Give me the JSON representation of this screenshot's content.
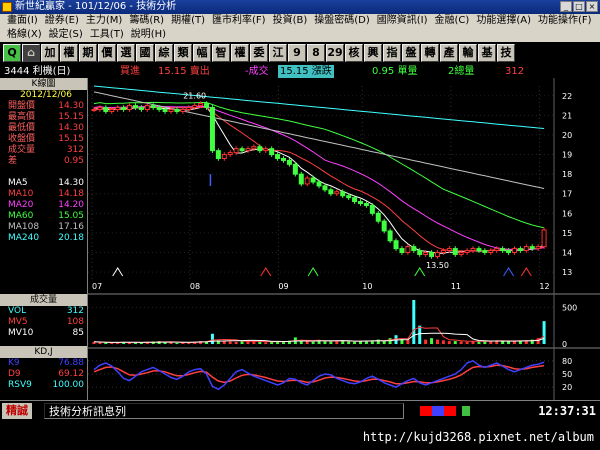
{
  "window": {
    "title": "新世紀贏家 - 101/12/06 - 技術分析"
  },
  "menu": {
    "row1": [
      "畫面(I)",
      "證券(E)",
      "主力(M)",
      "籌碼(R)",
      "期權(T)",
      "匯市利率(F)",
      "投資(B)",
      "操盤密碼(D)",
      "國際資訊(I)",
      "金融(C)",
      "功能選擇(A)",
      "功能操作(F)"
    ],
    "row2": [
      "格線(X)",
      "設定(S)",
      "工具(T)",
      "說明(H)"
    ]
  },
  "toolbar": {
    "buttons": [
      "Q",
      "⌂",
      "加",
      "權",
      "期",
      "價",
      "選",
      "國",
      "綜",
      "類",
      "幅",
      "智",
      "權",
      "委",
      "江",
      "9",
      "8",
      "29",
      "核",
      "興",
      "指",
      "盤",
      "轉",
      "產",
      "輪",
      "基",
      "技"
    ],
    "icons": [
      "search-icon",
      "home-icon"
    ]
  },
  "quote": {
    "stock": "3444 利機(日)",
    "bid_label": "買進",
    "bid_value": "15.15 賣出",
    "trade_label": "-成交",
    "trade_value": "15.15 漲跌",
    "change_value": "0.95 單量",
    "lots_value": "2總量",
    "total_value": "312"
  },
  "left_panel": {
    "k_header": "K線圖",
    "date": "2012/12/06",
    "price_rows": [
      {
        "k": "開盤價",
        "v": "14.30"
      },
      {
        "k": "最高價",
        "v": "15.15"
      },
      {
        "k": "最低價",
        "v": "14.30"
      },
      {
        "k": "收盤價",
        "v": "15.15"
      },
      {
        "k": "成交量",
        "v": "312"
      },
      {
        "k": "差",
        "v": "0.95"
      }
    ],
    "ma_rows": [
      {
        "k": "MA5",
        "v": "14.30",
        "color": "#ffffff"
      },
      {
        "k": "MA10",
        "v": "14.18",
        "color": "#ff4040"
      },
      {
        "k": "MA20",
        "v": "14.20",
        "color": "#ff40ff"
      },
      {
        "k": "MA60",
        "v": "15.05",
        "color": "#40ff40"
      },
      {
        "k": "MA108",
        "v": "17.16",
        "color": "#c0c0c0"
      },
      {
        "k": "MA240",
        "v": "20.18",
        "color": "#40ffff"
      }
    ],
    "vol_header": "成交量",
    "vol_rows": [
      {
        "k": "VOL",
        "v": "312",
        "color": "#40ffff"
      },
      {
        "k": "MV5",
        "v": "108",
        "color": "#ff4040"
      },
      {
        "k": "MV10",
        "v": "85",
        "color": "#ffffff"
      }
    ],
    "kd_header": "KD,J",
    "kd_rows": [
      {
        "k": "K9",
        "v": "76.88",
        "color": "#4040ff"
      },
      {
        "k": "D9",
        "v": "69.12",
        "color": "#ff4040"
      },
      {
        "k": "RSV9",
        "v": "100.00",
        "color": "#40ffff"
      }
    ]
  },
  "status": {
    "tag": "精誠",
    "message": "技術分析訊息列",
    "time": "12:37:31"
  },
  "footer": {
    "url": "http://kujd3268.pixnet.net/album"
  },
  "chart_data": [
    {
      "type": "candlestick",
      "x_ticks": [
        "07",
        "08",
        "09",
        "10",
        "11",
        "12"
      ],
      "y_ticks": [
        "22",
        "21",
        "20",
        "19",
        "18",
        "17",
        "16",
        "15",
        "14",
        "13"
      ],
      "ylim": [
        12.8,
        22.5
      ],
      "annotations": [
        {
          "text": "21.60"
        },
        {
          "text": "13.50"
        }
      ],
      "close": [
        21.3,
        21.4,
        21.2,
        21.3,
        21.4,
        21.3,
        21.5,
        21.4,
        21.3,
        21.5,
        21.4,
        21.3,
        21.2,
        21.3,
        21.2,
        21.3,
        21.4,
        21.5,
        21.6,
        21.4,
        19.2,
        18.8,
        19.0,
        19.1,
        19.3,
        19.2,
        19.3,
        19.4,
        19.2,
        19.3,
        19.0,
        18.8,
        18.7,
        18.5,
        18.0,
        17.5,
        17.8,
        17.6,
        17.4,
        17.2,
        17.0,
        17.1,
        16.9,
        16.8,
        16.6,
        16.5,
        16.4,
        16.0,
        15.6,
        15.1,
        14.6,
        14.2,
        14.0,
        14.3,
        14.1,
        13.9,
        14.0,
        13.8,
        14.0,
        14.1,
        14.2,
        13.9,
        14.0,
        14.1,
        14.2,
        14.1,
        14.0,
        14.1,
        14.2,
        14.1,
        14.0,
        14.2,
        14.1,
        14.3,
        14.2,
        14.3,
        15.15
      ],
      "series": [
        {
          "name": "MA5",
          "color": "#ffffff"
        },
        {
          "name": "MA10",
          "color": "#ff4040"
        },
        {
          "name": "MA20",
          "color": "#ff40ff"
        },
        {
          "name": "MA60",
          "color": "#40ff40"
        },
        {
          "name": "MA108",
          "color": "#c0c0c0"
        },
        {
          "name": "MA240",
          "color": "#40ffff"
        }
      ]
    },
    {
      "type": "bar",
      "y_ticks": [
        "500",
        "0"
      ],
      "ylim": [
        0,
        600
      ],
      "values": [
        30,
        25,
        20,
        15,
        20,
        30,
        25,
        20,
        15,
        30,
        35,
        40,
        25,
        20,
        15,
        20,
        25,
        30,
        40,
        35,
        140,
        50,
        40,
        35,
        30,
        45,
        40,
        35,
        30,
        25,
        30,
        40,
        35,
        45,
        90,
        40,
        35,
        30,
        55,
        45,
        35,
        40,
        50,
        35,
        30,
        40,
        45,
        50,
        60,
        40,
        80,
        120,
        70,
        60,
        640,
        250,
        60,
        80,
        60,
        50,
        40,
        40,
        35,
        30,
        40,
        45,
        35,
        40,
        50,
        45,
        40,
        35,
        45,
        50,
        60,
        80,
        312
      ]
    },
    {
      "type": "line",
      "y_ticks": [
        "80",
        "50",
        "20"
      ],
      "ylim": [
        0,
        100
      ],
      "k": [
        60,
        70,
        75,
        68,
        55,
        40,
        35,
        45,
        55,
        60,
        65,
        58,
        50,
        42,
        38,
        45,
        55,
        60,
        62,
        50,
        22,
        15,
        25,
        40,
        55,
        60,
        52,
        45,
        40,
        35,
        30,
        25,
        30,
        40,
        38,
        30,
        25,
        35,
        45,
        50,
        48,
        40,
        35,
        30,
        28,
        32,
        40,
        45,
        38,
        30,
        25,
        20,
        28,
        35,
        40,
        30,
        25,
        30,
        35,
        40,
        45,
        50,
        60,
        75,
        80,
        70,
        65,
        70,
        75,
        68,
        60,
        55,
        60,
        65,
        70,
        72,
        76.88
      ],
      "d": [
        55,
        60,
        65,
        66,
        62,
        55,
        48,
        47,
        50,
        53,
        57,
        57,
        55,
        50,
        46,
        46,
        49,
        53,
        56,
        54,
        43,
        34,
        31,
        34,
        41,
        47,
        49,
        48,
        45,
        42,
        38,
        34,
        33,
        35,
        36,
        34,
        31,
        32,
        36,
        41,
        43,
        42,
        40,
        37,
        34,
        33,
        35,
        38,
        38,
        35,
        32,
        28,
        28,
        30,
        33,
        32,
        30,
        30,
        32,
        35,
        38,
        42,
        48,
        57,
        65,
        67,
        66,
        67,
        70,
        69,
        66,
        62,
        61,
        62,
        65,
        67,
        69.12
      ],
      "series": [
        {
          "name": "K9",
          "color": "#4040ff"
        },
        {
          "name": "D9",
          "color": "#ff4040"
        }
      ]
    }
  ]
}
